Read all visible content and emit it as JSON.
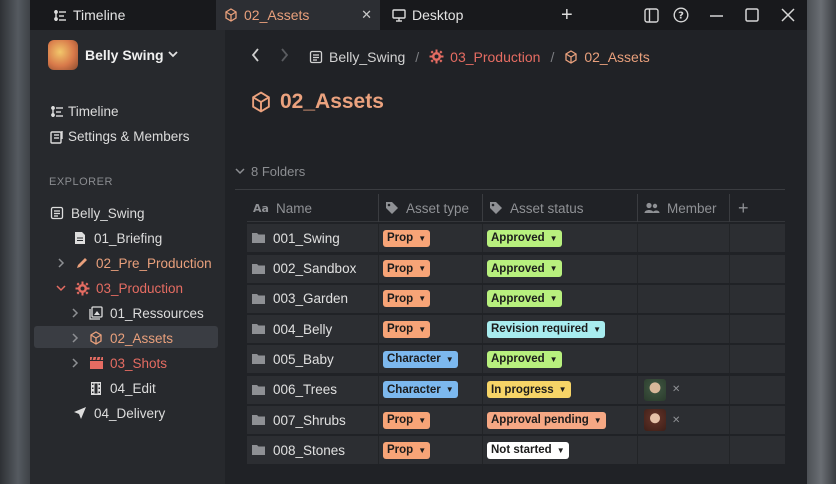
{
  "titlebar": {
    "tabs": [
      {
        "label": "Timeline"
      },
      {
        "label": "02_Assets"
      },
      {
        "label": "Desktop"
      }
    ],
    "close_tab": "✕",
    "add_tab": "+"
  },
  "sidebar": {
    "project_name": "Belly Swing",
    "nav": [
      {
        "label": "Timeline"
      },
      {
        "label": "Settings & Members"
      }
    ],
    "explorer_label": "EXPLORER",
    "tree": [
      {
        "label": "Belly_Swing"
      },
      {
        "label": "01_Briefing"
      },
      {
        "label": "02_Pre_Production"
      },
      {
        "label": "03_Production"
      },
      {
        "label": "01_Ressources"
      },
      {
        "label": "02_Assets"
      },
      {
        "label": "03_Shots"
      },
      {
        "label": "04_Edit"
      },
      {
        "label": "04_Delivery"
      }
    ]
  },
  "breadcrumb": [
    {
      "label": "Belly_Swing"
    },
    {
      "label": "03_Production"
    },
    {
      "label": "02_Assets"
    }
  ],
  "breadcrumb_sep": "/",
  "page_title": "02_Assets",
  "folders_count": "8 Folders",
  "table": {
    "headers": {
      "name": "Name",
      "type": "Asset type",
      "status": "Asset status",
      "member": "Member",
      "add": "+"
    },
    "rows": [
      {
        "name": "001_Swing",
        "type": "Prop",
        "status": "Approved"
      },
      {
        "name": "002_Sandbox",
        "type": "Prop",
        "status": "Approved"
      },
      {
        "name": "003_Garden",
        "type": "Prop",
        "status": "Approved"
      },
      {
        "name": "004_Belly",
        "type": "Prop",
        "status": "Revision required"
      },
      {
        "name": "005_Baby",
        "type": "Character",
        "status": "Approved"
      },
      {
        "name": "006_Trees",
        "type": "Character",
        "status": "In progress"
      },
      {
        "name": "007_Shrubs",
        "type": "Prop",
        "status": "Approval pending"
      },
      {
        "name": "008_Stones",
        "type": "Prop",
        "status": "Not started"
      }
    ]
  },
  "colors": {
    "accent_orange": "#eba27e",
    "accent_red": "#e56c62",
    "tag_prop": "#f7a477",
    "tag_character": "#7cb8ee",
    "tag_approved": "#b8f07e",
    "tag_revision": "#a8ecef",
    "tag_progress": "#f6d467",
    "tag_pending": "#f6a884",
    "tag_not_started": "#ffffff"
  },
  "icons": [
    "timeline-icon",
    "assets-icon",
    "desktop-icon",
    "sidebar-toggle-icon",
    "help-icon",
    "minimize-icon",
    "maximize-icon",
    "close-icon",
    "folder-icon",
    "tag-icon",
    "members-icon",
    "gear-icon",
    "pencil-icon",
    "film-icon",
    "send-icon",
    "document-icon"
  ]
}
